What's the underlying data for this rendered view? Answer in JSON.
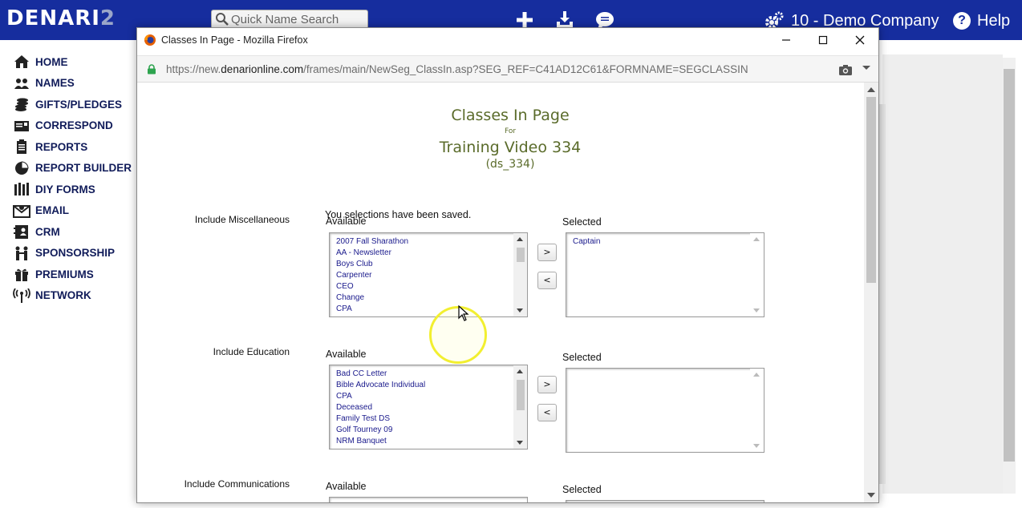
{
  "app": {
    "logo_main": "DENARI",
    "logo_num": "2",
    "search_placeholder": "Quick Name Search",
    "company": "10 - Demo Company",
    "help": "Help"
  },
  "sidebar": {
    "items": [
      {
        "label": "HOME",
        "icon": "home-icon"
      },
      {
        "label": "NAMES",
        "icon": "people-icon"
      },
      {
        "label": "GIFTS/PLEDGES",
        "icon": "coins-icon"
      },
      {
        "label": "CORRESPOND",
        "icon": "letter-icon"
      },
      {
        "label": "REPORTS",
        "icon": "clipboard-icon"
      },
      {
        "label": "REPORT BUILDER",
        "icon": "pie-icon"
      },
      {
        "label": "DIY FORMS",
        "icon": "forms-icon"
      },
      {
        "label": "EMAIL",
        "icon": "envelope-icon"
      },
      {
        "label": "CRM",
        "icon": "contact-card-icon"
      },
      {
        "label": "SPONSORSHIP",
        "icon": "sponsorship-icon"
      },
      {
        "label": "PREMIUMS",
        "icon": "gift-icon"
      },
      {
        "label": "NETWORK",
        "icon": "antenna-icon"
      }
    ]
  },
  "popup": {
    "window_title": "Classes In Page - Mozilla Firefox",
    "url_prefix": "https://new.",
    "url_domain": "denarionline.com",
    "url_path": "/frames/main/NewSeg_ClassIn.asp?SEG_REF=C41AD12C61&FORMNAME=SEGCLASSIN",
    "page_title": "Classes In Page",
    "for_label": "For",
    "segment_name": "Training Video 334",
    "segment_code": "(ds_334)",
    "saved_message": "You selections have been saved.",
    "sections": [
      {
        "label": "Include Miscellaneous",
        "available_label": "Available",
        "selected_label": "Selected",
        "available": [
          "2007 Fall Sharathon",
          "AA - Newsletter",
          "Boys Club",
          "Carpenter",
          "CEO",
          "Change",
          "CPA"
        ],
        "selected": [
          "Captain"
        ],
        "add_button": ">",
        "remove_button": "<"
      },
      {
        "label": "Include Education",
        "available_label": "Available",
        "selected_label": "Selected",
        "available": [
          "Bad CC Letter",
          "Bible Advocate Individual",
          "CPA",
          "Deceased",
          "Family Test DS",
          "Golf Tourney 09",
          "NRM Banquet"
        ],
        "selected": [],
        "add_button": ">",
        "remove_button": "<"
      },
      {
        "label": "Include Communications",
        "available_label": "Available",
        "selected_label": "Selected"
      }
    ]
  },
  "colors": {
    "topbar": "#162d9e",
    "heading": "#5a6b2a",
    "list_text": "#1a1a8c",
    "highlight": "#f2ef30"
  }
}
